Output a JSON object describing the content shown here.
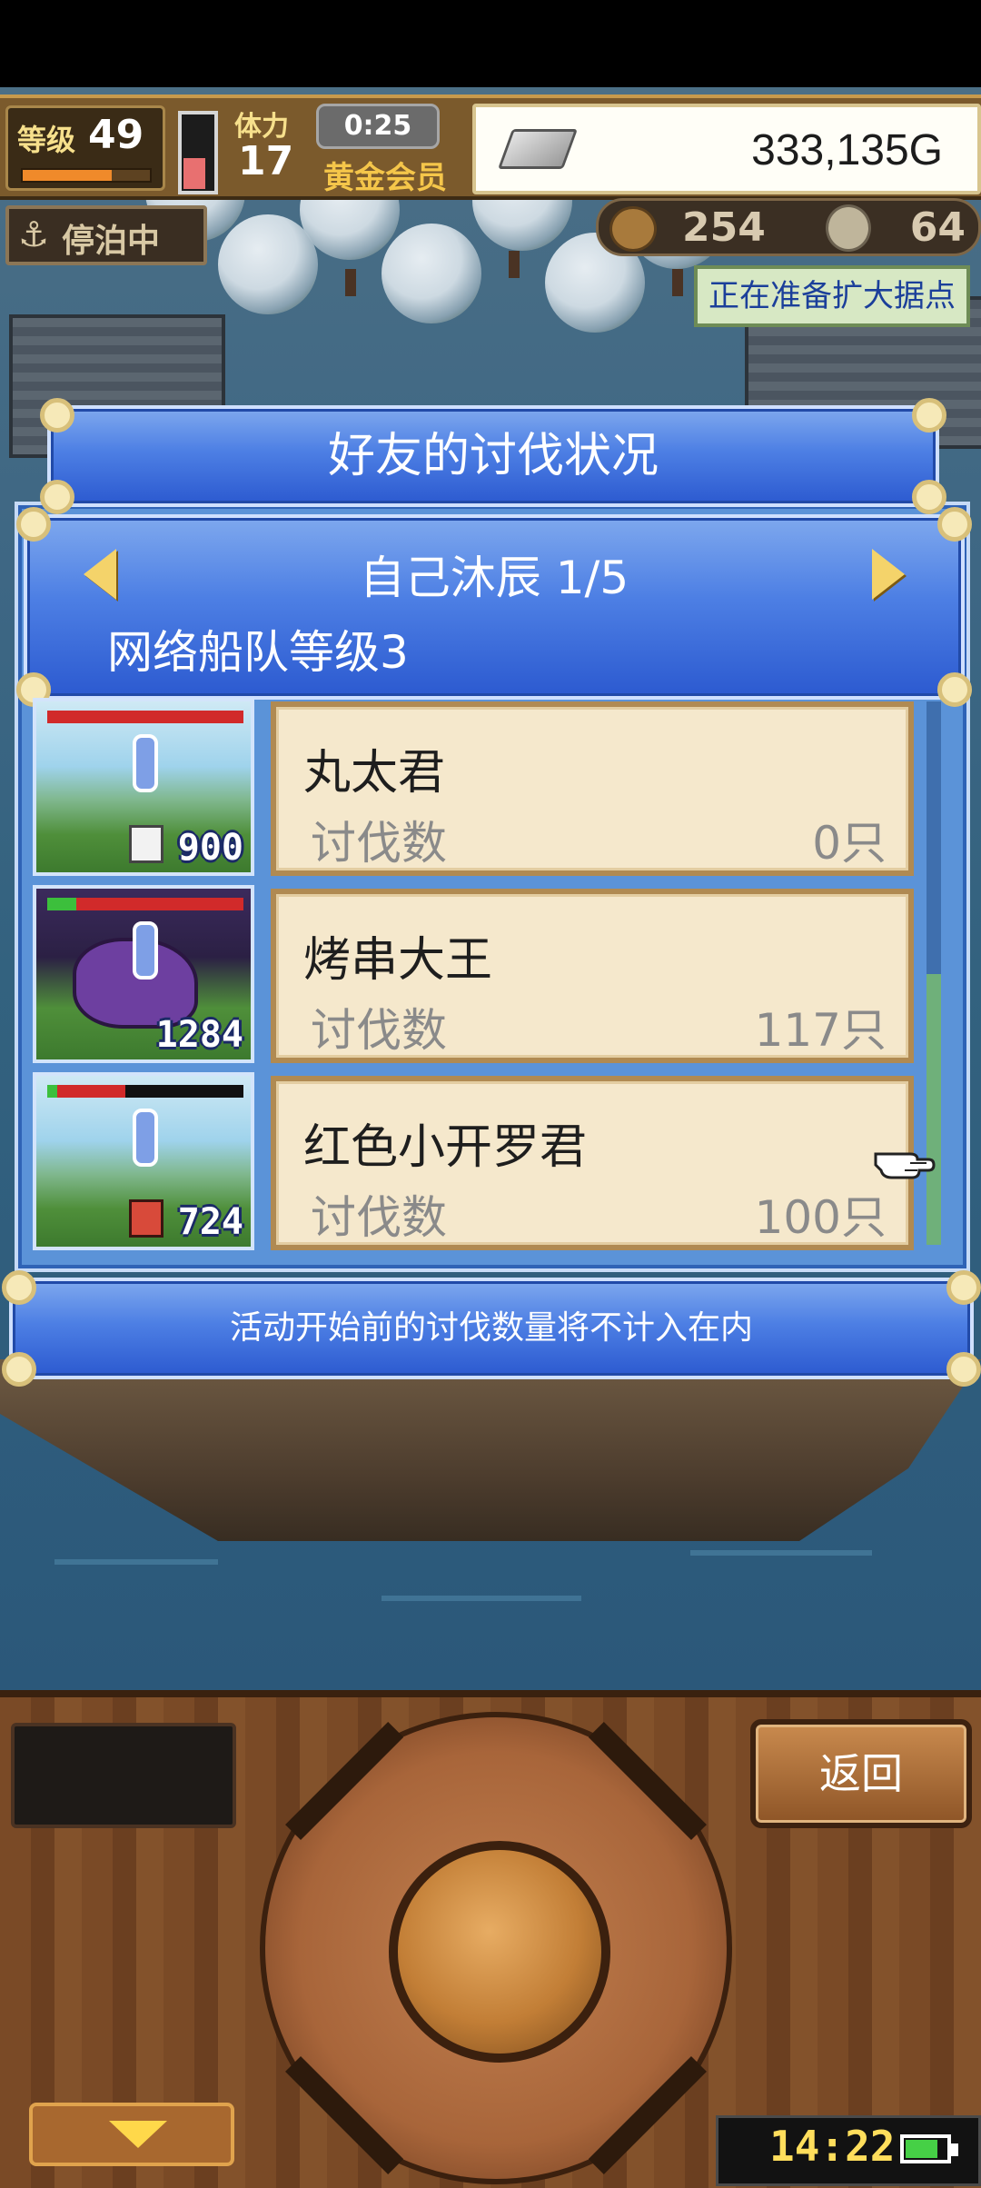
{
  "hud": {
    "level_label": "等级",
    "level": "49",
    "exp_fraction": 0.7,
    "stamina_label": "体力",
    "stamina": "17",
    "stamina_fraction": 0.45,
    "timer": "0:25",
    "membership": "黄金会员",
    "gold": "333,135G",
    "docked_label": "停泊中",
    "resource_1": "254",
    "resource_2": "64",
    "expand_notice": "正在准备扩大据点"
  },
  "dialog": {
    "title": "好友的讨伐状况",
    "friend_name": "自己沐辰 1/5",
    "fleet_level": "网络船队等级3",
    "kill_label": "讨伐数",
    "rows": [
      {
        "name": "丸太君",
        "kills": "0只",
        "count": "900",
        "hp_green": 0.0,
        "hp_red": 1.0
      },
      {
        "name": "烤串大王",
        "kills": "117只",
        "count": "1284",
        "hp_green": 0.15,
        "hp_red": 0.85
      },
      {
        "name": "红色小开罗君",
        "kills": "100只",
        "count": "724",
        "hp_green": 0.05,
        "hp_red": 0.35
      }
    ],
    "note": "活动开始前的讨伐数量将不计入在内"
  },
  "console": {
    "back_label": "返回",
    "clock": "14:22",
    "battery_fraction": 0.8
  },
  "colors": {
    "dialog_blue": "#4d7fe4",
    "card_bg": "#f5e8cc",
    "gold_text": "#f5c64a"
  }
}
